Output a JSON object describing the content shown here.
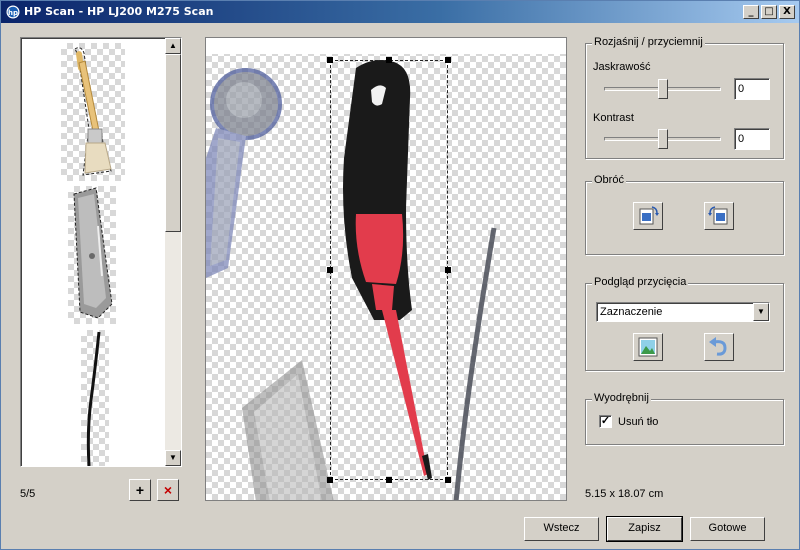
{
  "window": {
    "title": "HP Scan - HP LJ200 M275 Scan"
  },
  "titlebar_buttons": {
    "minimize": "_",
    "maximize": "□",
    "close": "X"
  },
  "thumbnails": {
    "counter": "5/5",
    "items": [
      "brush",
      "utility-knife",
      "cable"
    ],
    "add_button": "+",
    "remove_button": "×"
  },
  "brighten_darken": {
    "legend": "Rozjaśnij / przyciemnij",
    "brightness_label": "Jaskrawość",
    "brightness_value": "0",
    "brightness_level": 0.5,
    "contrast_label": "Kontrast",
    "contrast_value": "0",
    "contrast_level": 0.5
  },
  "rotate": {
    "legend": "Obróć",
    "buttons": [
      "rotate-left-icon",
      "rotate-right-icon"
    ]
  },
  "crop_preview": {
    "legend": "Podgląd przycięcia",
    "selected_option": "Zaznaczenie",
    "buttons": [
      "image-preview-icon",
      "undo-icon"
    ]
  },
  "extract": {
    "legend": "Wyodrębnij",
    "remove_background_label": "Usuń tło",
    "remove_background_checked": true
  },
  "dimensions": "5.15 x 18.07 cm",
  "footer": {
    "back": "Wstecz",
    "save": "Zapisz",
    "done": "Gotowe"
  },
  "colors": {
    "accent": "#0a246a",
    "handle_red": "#e23c4c",
    "background": "#d4d0c8"
  }
}
